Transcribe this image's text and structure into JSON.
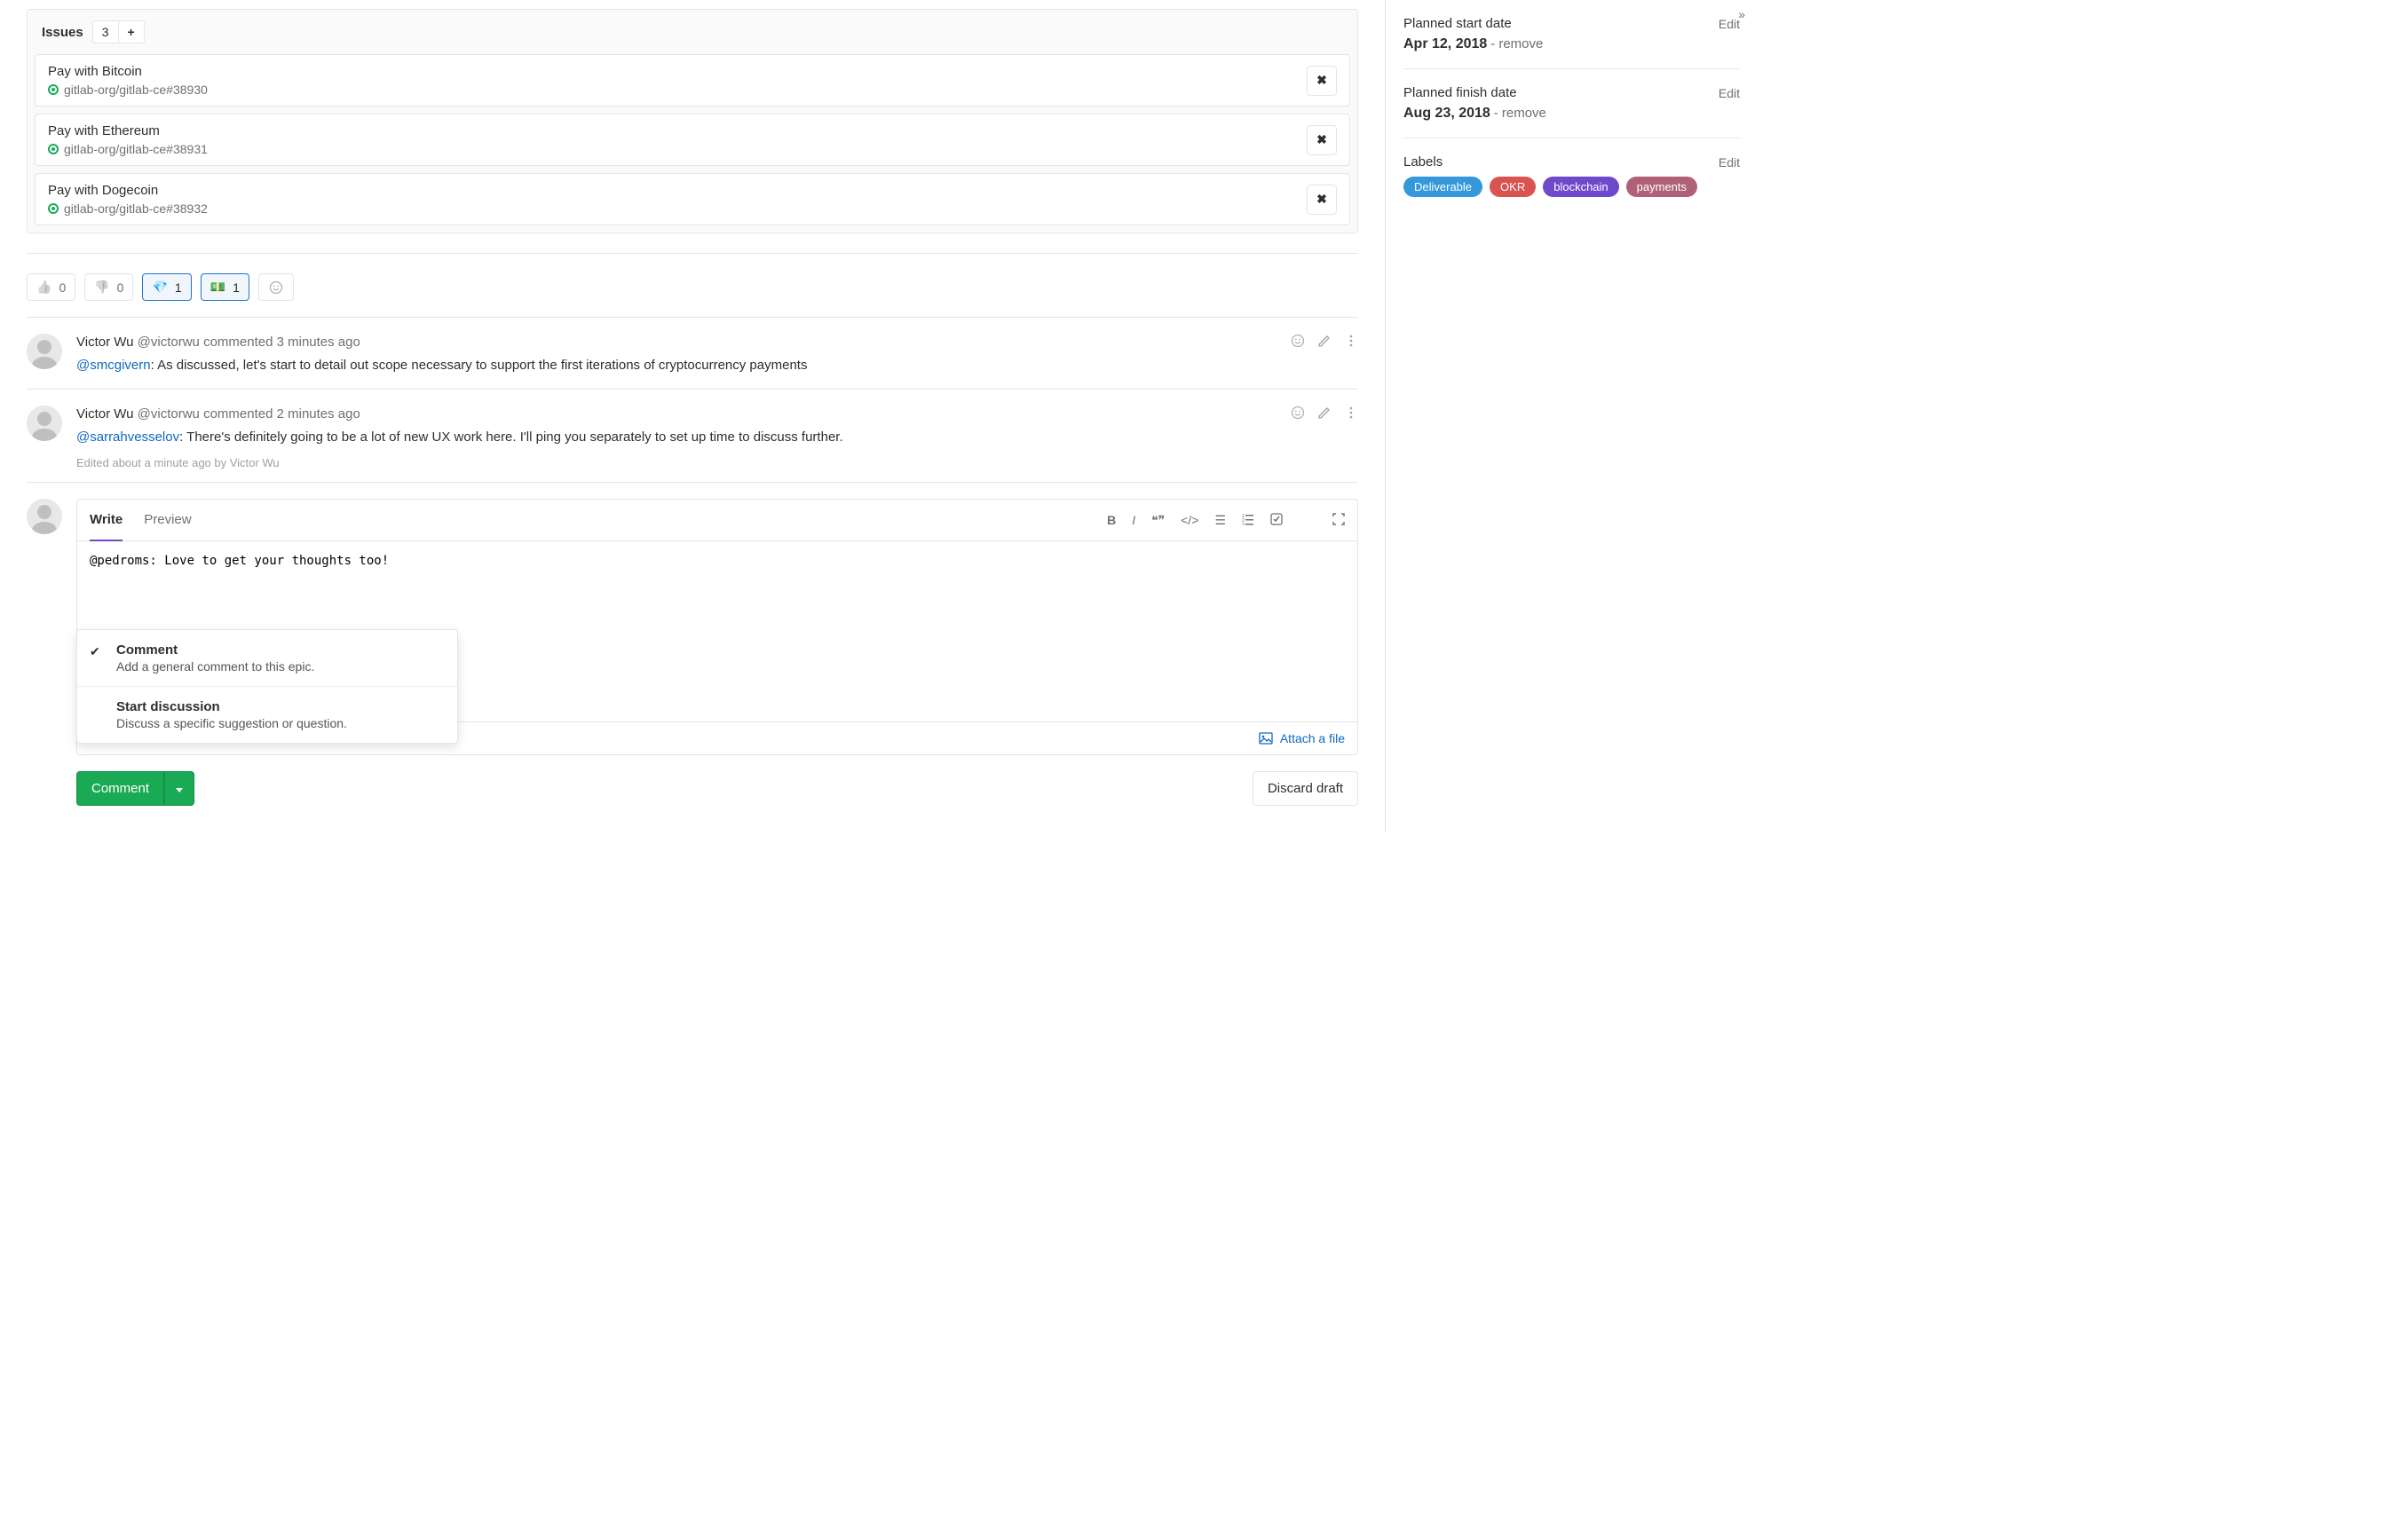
{
  "issues": {
    "header_label": "Issues",
    "count": "3",
    "add_label": "+",
    "items": [
      {
        "title": "Pay with Bitcoin",
        "ref": "gitlab-org/gitlab-ce#38930"
      },
      {
        "title": "Pay with Ethereum",
        "ref": "gitlab-org/gitlab-ce#38931"
      },
      {
        "title": "Pay with Dogecoin",
        "ref": "gitlab-org/gitlab-ce#38932"
      }
    ]
  },
  "reactions": {
    "thumbs_up": {
      "emoji": "👍",
      "count": "0"
    },
    "thumbs_down": {
      "emoji": "👎",
      "count": "0"
    },
    "gem": {
      "emoji": "💎",
      "count": "1"
    },
    "dollar": {
      "emoji": "💵",
      "count": "1"
    }
  },
  "comments": [
    {
      "author": "Victor Wu",
      "handle": "@victorwu",
      "verb": "commented",
      "time": "3 minutes ago",
      "mention": "@smcgivern",
      "text": ": As discussed, let's start to detail out scope necessary to support the first iterations of cryptocurrency payments",
      "edited": ""
    },
    {
      "author": "Victor Wu",
      "handle": "@victorwu",
      "verb": "commented",
      "time": "2 minutes ago",
      "mention": "@sarrahvesselov",
      "text": ": There's definitely going to be a lot of new UX work here. I'll ping you separately to set up time to discuss further.",
      "edited": "Edited about a minute ago by Victor Wu"
    }
  ],
  "compose": {
    "write_tab": "Write",
    "preview_tab": "Preview",
    "text": "@pedroms: Love to get your thoughts too!",
    "attach_label": "Attach a file"
  },
  "dropdown": {
    "comment": {
      "title": "Comment",
      "desc": "Add a general comment to this epic."
    },
    "discussion": {
      "title": "Start discussion",
      "desc": "Discuss a specific suggestion or question."
    }
  },
  "buttons": {
    "comment": "Comment",
    "discard": "Discard draft"
  },
  "sidebar": {
    "start": {
      "label": "Planned start date",
      "edit": "Edit",
      "date": "Apr 12, 2018",
      "remove": " - remove"
    },
    "finish": {
      "label": "Planned finish date",
      "edit": "Edit",
      "date": "Aug 23, 2018",
      "remove": " - remove"
    },
    "labels": {
      "label": "Labels",
      "edit": "Edit",
      "items": [
        "Deliverable",
        "OKR",
        "blockchain",
        "payments"
      ]
    },
    "collapse": "»"
  }
}
